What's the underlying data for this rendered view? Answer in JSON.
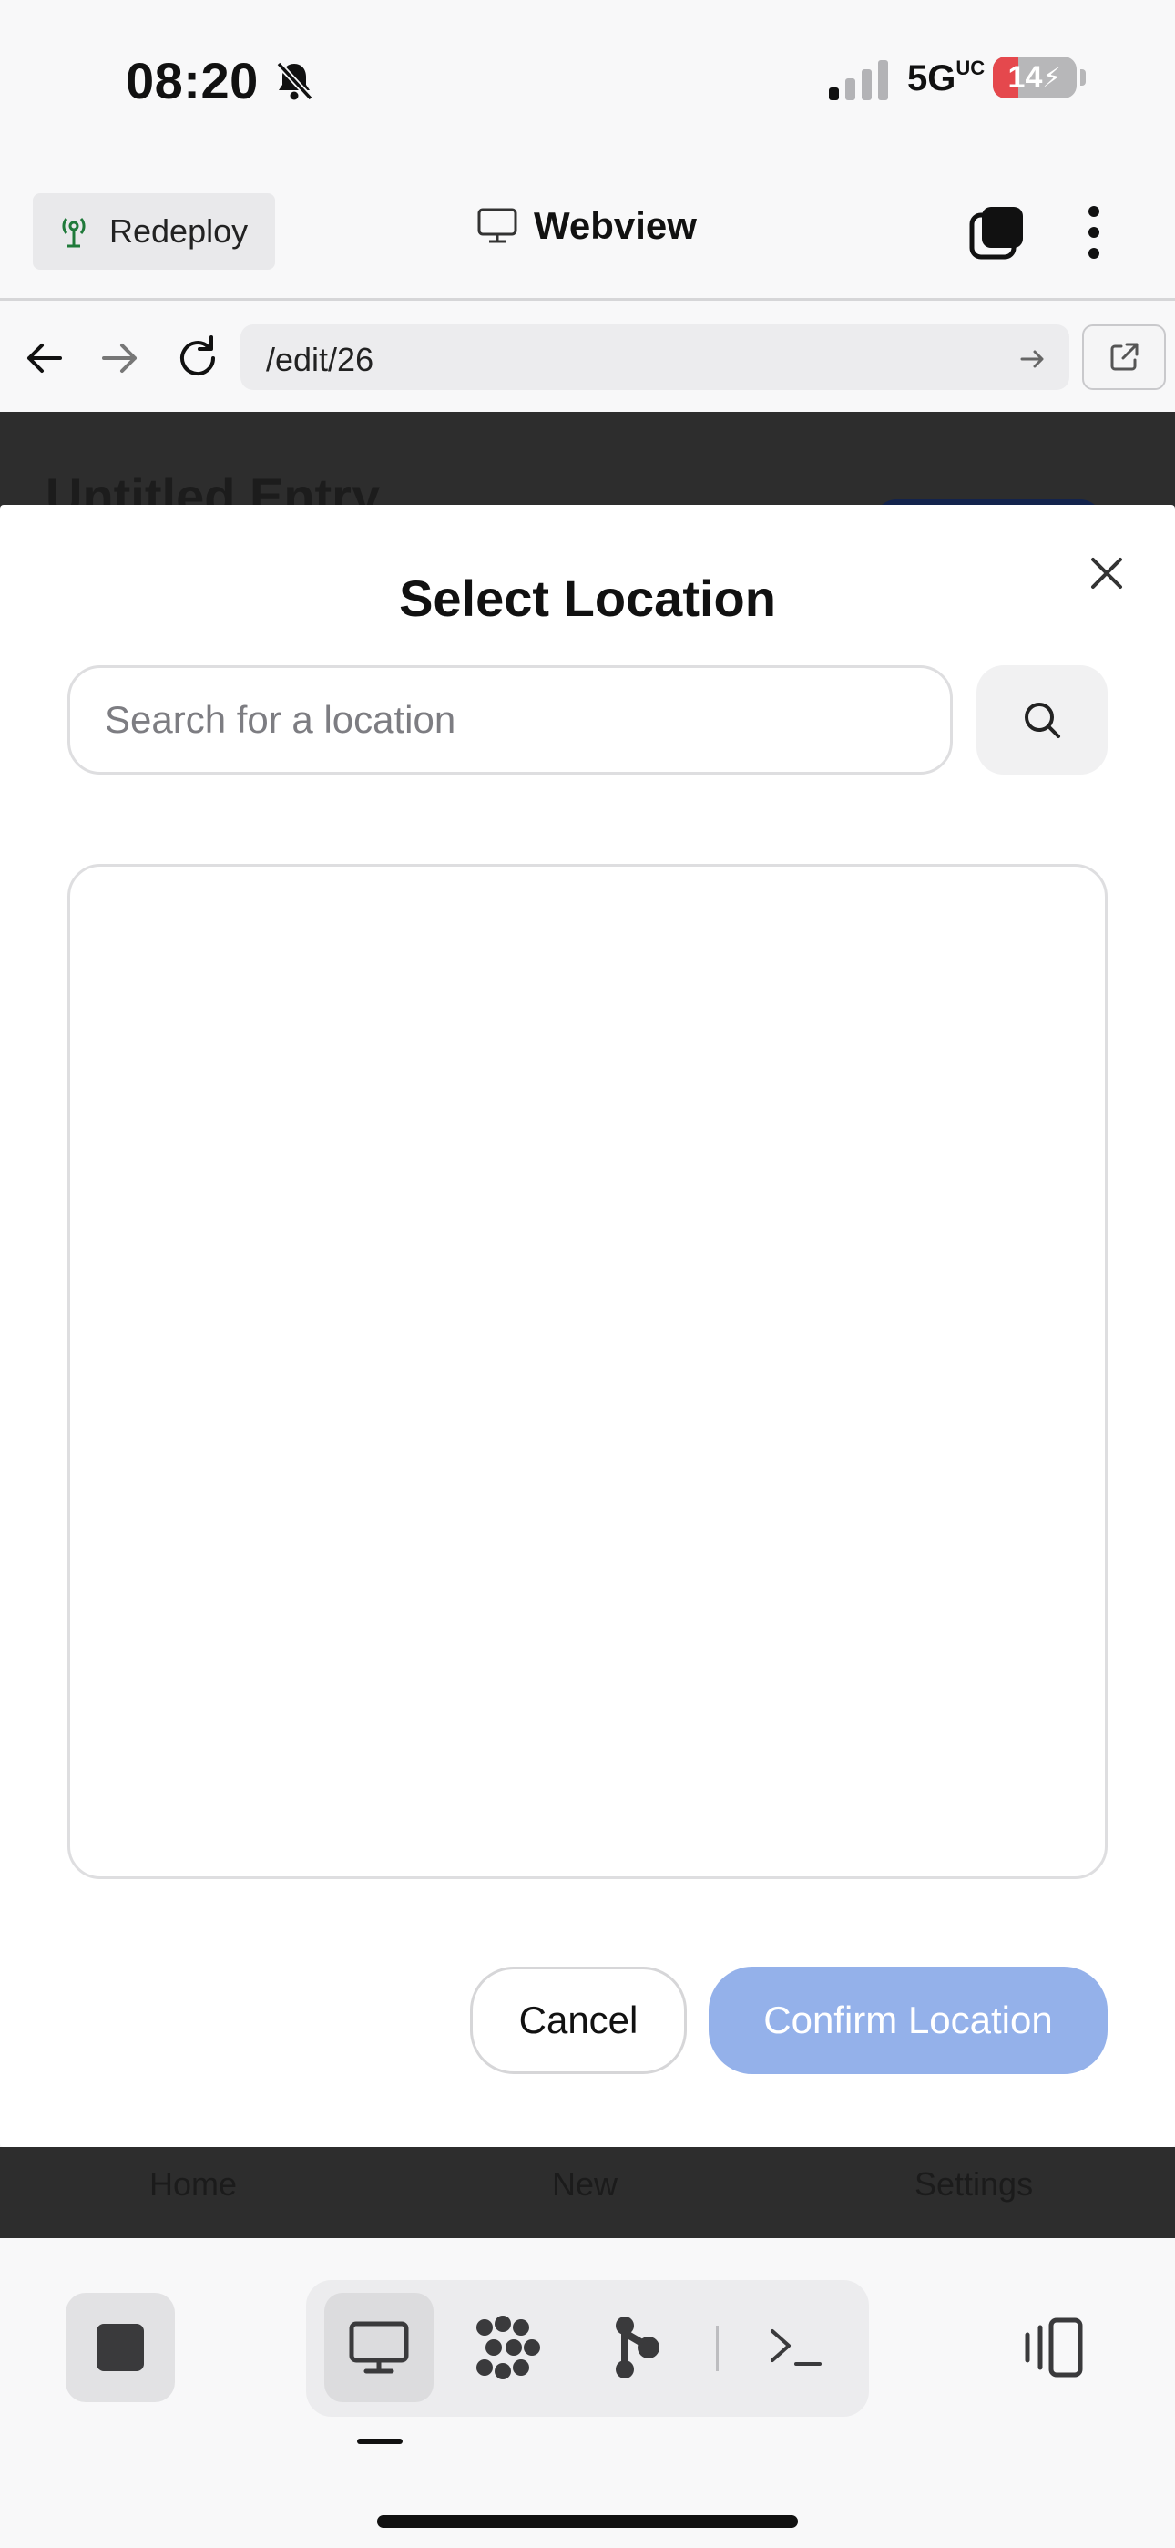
{
  "status_bar": {
    "time": "08:20",
    "network": "5G",
    "network_suffix": "UC",
    "battery_percent": 14,
    "battery_label": "14"
  },
  "header": {
    "redeploy_label": "Redeploy",
    "title": "Webview"
  },
  "browser": {
    "url": "/edit/26"
  },
  "webpage": {
    "title": "Untitled Entry",
    "nav_items": [
      "Home",
      "New",
      "Settings"
    ]
  },
  "modal": {
    "title": "Select Location",
    "search_placeholder": "Search for a location",
    "search_value": "",
    "cancel_label": "Cancel",
    "confirm_label": "Confirm Location",
    "confirm_color": "#94b1ea"
  },
  "toolbar": {
    "items": [
      "desktop-icon",
      "apps-icon",
      "branch-icon",
      "terminal-icon"
    ],
    "active_item": "desktop-icon"
  }
}
